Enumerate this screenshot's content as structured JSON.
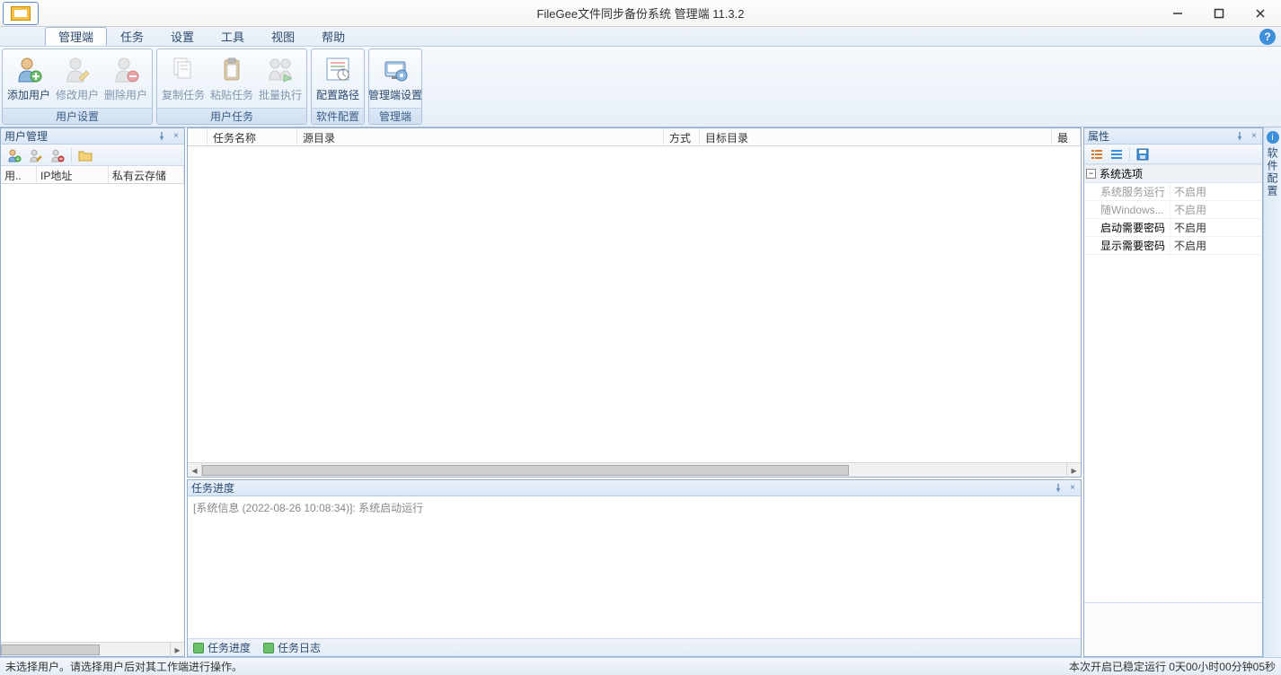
{
  "window": {
    "title": "FileGee文件同步备份系统 管理端 11.3.2"
  },
  "menu_tabs": [
    "管理端",
    "任务",
    "设置",
    "工具",
    "视图",
    "帮助"
  ],
  "menu_active_index": 0,
  "ribbon": {
    "groups": [
      {
        "title": "用户设置",
        "buttons": [
          {
            "label": "添加用户",
            "icon": "user-add",
            "enabled": true
          },
          {
            "label": "修改用户",
            "icon": "user-edit",
            "enabled": false
          },
          {
            "label": "删除用户",
            "icon": "user-delete",
            "enabled": false
          }
        ]
      },
      {
        "title": "用户任务",
        "buttons": [
          {
            "label": "复制任务",
            "icon": "copy",
            "enabled": false
          },
          {
            "label": "粘贴任务",
            "icon": "paste",
            "enabled": false
          },
          {
            "label": "批量执行",
            "icon": "batch-run",
            "enabled": false
          }
        ]
      },
      {
        "title": "软件配置",
        "buttons": [
          {
            "label": "配置路径",
            "icon": "config-path",
            "enabled": true
          }
        ]
      },
      {
        "title": "管理端",
        "buttons": [
          {
            "label": "管理端设置",
            "icon": "mgmt-settings",
            "enabled": true
          }
        ]
      }
    ]
  },
  "left_panel": {
    "title": "用户管理",
    "columns": [
      "用..",
      "IP地址",
      "私有云存储"
    ]
  },
  "task_panel": {
    "columns": [
      "任务名称",
      "源目录",
      "方式",
      "目标目录",
      "最"
    ]
  },
  "progress_panel": {
    "title": "任务进度",
    "log_line": "[系统信息 (2022-08-26 10:08:34)]: 系统启动运行",
    "tabs": [
      "任务进度",
      "任务日志"
    ]
  },
  "right_panel": {
    "title": "属性",
    "category": "系统选项",
    "rows": [
      {
        "key": "系统服务运行",
        "value": "不启用",
        "disabled": true
      },
      {
        "key": "随Windows...",
        "value": "不启用",
        "disabled": true
      },
      {
        "key": "启动需要密码",
        "value": "不启用",
        "disabled": false
      },
      {
        "key": "显示需要密码",
        "value": "不启用",
        "disabled": false
      }
    ]
  },
  "side_tab": {
    "label": "软件配置"
  },
  "statusbar": {
    "left": "未选择用户。请选择用户后对其工作端进行操作。",
    "right": "本次开启已稳定运行 0天00小时00分钟05秒"
  }
}
